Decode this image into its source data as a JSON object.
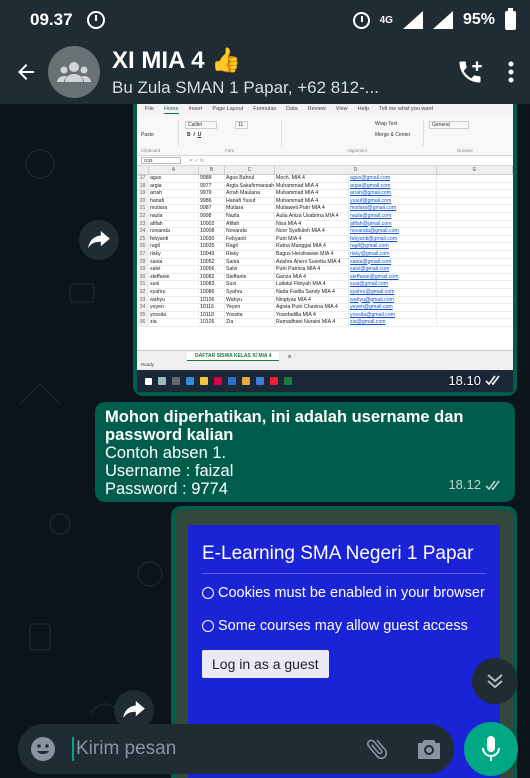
{
  "status_bar": {
    "time": "09.37",
    "network": "4G",
    "battery": "95%"
  },
  "header": {
    "title": "XI MIA 4 👍",
    "subtitle": "Bu Zula SMAN 1 Papar, +62 812-..."
  },
  "image_message_1": {
    "time": "18.10",
    "ribbon_tabs": [
      "File",
      "Home",
      "Insert",
      "Page Layout",
      "Formulas",
      "Data",
      "Review",
      "View",
      "Help",
      "Tell me what you want"
    ],
    "ribbon": {
      "font": "Calibri",
      "size": "11",
      "wrap_text": "Wrap Text",
      "merge": "Merge & Center",
      "format": "General",
      "groups": [
        "Clipboard",
        "Font",
        "Alignment",
        "Number"
      ],
      "paste": "Paste"
    },
    "name_box": "G33",
    "columns": [
      "A",
      "B",
      "C",
      "D",
      "E"
    ],
    "rows": [
      [
        "17",
        "agus",
        "9988",
        "Agus Bahrul",
        "Moch. MIA 4",
        "agus@gmail.com"
      ],
      [
        "18",
        "argia",
        "9977",
        "Argia Sakafirmansah",
        "Muhammad MIA 4",
        "argia@gmail.com"
      ],
      [
        "19",
        "arrah",
        "9979",
        "Arrah Maulana",
        "Muhammad MIA 4",
        "arrah@gmail.com"
      ],
      [
        "20",
        "hanafi",
        "9986",
        "Hanafi Yusuf",
        "Muhammad MIA 4",
        "yusuf@gmail.com"
      ],
      [
        "21",
        "mutiara",
        "9987",
        "Mutiara",
        "Mutiaweti Putri MIA 4",
        "mutiara@gmail.com"
      ],
      [
        "22",
        "nazla",
        "9998",
        "Nazla",
        "Aulia Aniza Usabrina MIA 4",
        "nazla@gmail.com"
      ],
      [
        "23",
        "afifah",
        "10002",
        "Afifah",
        "Nisa MIA 4",
        "afifah@gmail.com"
      ],
      [
        "24",
        "novanda",
        "10008",
        "Novanda",
        "Noor Syafiuloh MIA 4",
        "novanda@gmail.com"
      ],
      [
        "25",
        "febyanti",
        "10030",
        "Febyanti",
        "Putri MIA 4",
        "febyanti@gmail.com"
      ],
      [
        "26",
        "ragil",
        "10035",
        "Ragil",
        "Ratna Manggal MIA 4",
        "ragil@gmail.com"
      ],
      [
        "27",
        "risky",
        "10049",
        "Risky",
        "Bagus Hendrawan MIA 4",
        "risky@gmail.com"
      ],
      [
        "28",
        "sania",
        "10052",
        "Sania",
        "Azahra Arieni Susetta MIA 4",
        "sania@gmail.com"
      ],
      [
        "29",
        "salvi",
        "10056",
        "Salvi",
        "Putri Patricia MIA 4",
        "salvi@gmail.com"
      ],
      [
        "30",
        "steffanie",
        "10082",
        "Steffanie",
        "Ganza MIA 4",
        "steffanie@gmail.com"
      ],
      [
        "31",
        "susi",
        "10083",
        "Susi",
        "Lailatul Fitriyah MIA 4",
        "susi@gmail.com"
      ],
      [
        "32",
        "syahru",
        "10086",
        "Syahru",
        "Nada Fadila Sandy MIA 4",
        "syahru@gmail.com"
      ],
      [
        "33",
        "wahyu",
        "10106",
        "Wahyu",
        "Ningtyas MIA 4",
        "wahyu@gmail.com"
      ],
      [
        "34",
        "yeyen",
        "10116",
        "Yeyen",
        "Agista Putri Chavina MIA 4",
        "yeyen@gmail.com"
      ],
      [
        "35",
        "yossita",
        "10118",
        "Yossita",
        "Yoanfadilla MIA 4",
        "yossita@gmail.com"
      ],
      [
        "36",
        "zia",
        "10126",
        "Zia",
        "Ramadhani Nuraini MIA 4",
        "zia@gmail.com"
      ]
    ],
    "sheet_tab": "DAFTAR SISWA KELAS XI MIA 4",
    "status": "Ready"
  },
  "text_message": {
    "bold_text": "Mohon diperhatikan, ini adalah username dan password kalian",
    "lines": [
      "Contoh absen 1.",
      "Username : faizal",
      "Password : 9774"
    ],
    "time": "18.12"
  },
  "image_message_2": {
    "title": "E-Learning SMA Negeri 1 Papar",
    "cookies_notice": "Cookies must be enabled in your browser",
    "guest_notice": "Some courses may allow guest access",
    "guest_button": "Log in as a guest"
  },
  "input": {
    "placeholder": "Kirim pesan"
  },
  "colors": {
    "bubble": "#005c4b",
    "header": "#1f2c34",
    "background": "#0b141a",
    "accent": "#00a884",
    "elearning_blue": "#1a24d6"
  }
}
